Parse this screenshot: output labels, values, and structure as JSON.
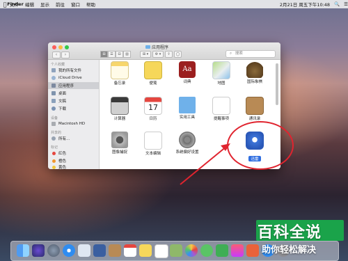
{
  "menubar": {
    "apple": "",
    "app": "Finder",
    "items": [
      "文件",
      "编辑",
      "显示",
      "前往",
      "窗口",
      "帮助"
    ],
    "right": {
      "datetime": "2月21日 周五下午10:48",
      "search": "🔍",
      "list": "☰"
    }
  },
  "window": {
    "title": "应用程序",
    "search_placeholder": "搜索",
    "search_icon": "⌕",
    "nav": {
      "back": "‹",
      "forward": "›"
    },
    "view_icons": [
      "⊞",
      "☰",
      "⊟",
      "▥"
    ],
    "arrange": "⊞ ▾",
    "action": "⚙ ▾",
    "share": "⇪",
    "tags": "◯"
  },
  "sidebar": {
    "favorites_header": "个人收藏",
    "favorites": [
      {
        "label": "我的所有文件",
        "icon": "all-files-icon"
      },
      {
        "label": "iCloud Drive",
        "icon": "cloud-icon"
      },
      {
        "label": "应用程序",
        "icon": "applications-icon"
      },
      {
        "label": "桌面",
        "icon": "desktop-icon"
      },
      {
        "label": "文稿",
        "icon": "documents-icon"
      },
      {
        "label": "下载",
        "icon": "downloads-icon"
      }
    ],
    "devices_header": "设备",
    "devices": [
      {
        "label": "Macintosh HD",
        "icon": "disk-icon"
      }
    ],
    "shared_header": "共享的",
    "shared": [
      {
        "label": "所有...",
        "icon": "network-icon"
      }
    ],
    "tags_header": "标记",
    "tags": [
      {
        "label": "红色",
        "color": "#e5463f"
      },
      {
        "label": "橙色",
        "color": "#f0962f"
      },
      {
        "label": "黄色",
        "color": "#f3c93c"
      }
    ]
  },
  "apps": {
    "row1": [
      "备忘录",
      "便笺",
      "词典",
      "地图",
      "国际象棋"
    ],
    "row2": [
      "计算器",
      "日历",
      "实用工具",
      "提醒事项",
      "通讯录"
    ],
    "row3": [
      "图像捕捉",
      "文本编辑",
      "系统偏好设置",
      "迅雷"
    ]
  },
  "annotation": {
    "color": "#e0242f"
  },
  "watermark": {
    "title": "百科全说",
    "subtitle": "助你轻松解决"
  }
}
